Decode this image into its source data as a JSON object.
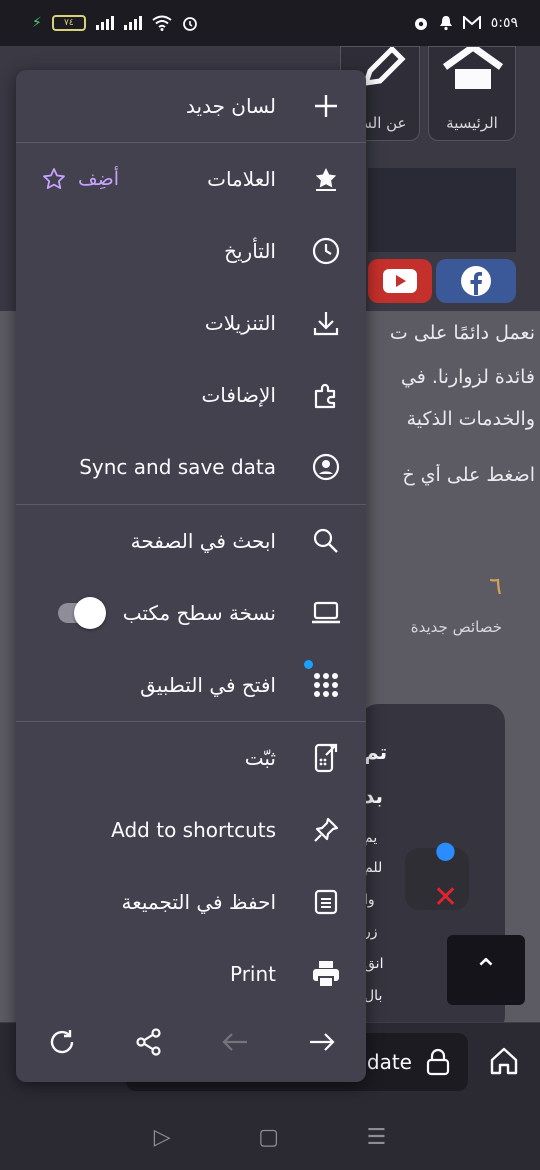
{
  "status_bar": {
    "battery": "٧٤",
    "time": "٥:٥٩",
    "icons": [
      "charging-icon",
      "signal-icon",
      "wifi-icon",
      "alarm-icon",
      "vpn-icon",
      "notification-icon",
      "gmail-icon"
    ]
  },
  "background_page": {
    "nav": [
      "الرئيسية",
      "عن الش"
    ],
    "text_lines": [
      "نعمل دائمًا على ت",
      "فائدة لزوارنا. في",
      "والخدمات الذكية",
      "اضغط على أي خ"
    ],
    "number": "٦",
    "features_label": "خصائص جديدة",
    "card_lines": [
      "تم",
      "بد",
      "يم",
      "للم",
      "وا",
      "زر",
      "انق",
      "بال"
    ],
    "url_fragment": "date"
  },
  "menu": {
    "items": {
      "new_tab": "لسان جديد",
      "bookmarks": "العلامات",
      "add_bookmark": "أضِف",
      "history": "التأريخ",
      "downloads": "التنزيلات",
      "addons": "الإضافات",
      "sync": "Sync and save data",
      "find_in_page": "ابحث في الصفحة",
      "desktop_site": "نسخة سطح مكتب",
      "open_in_app": "افتح في التطبيق",
      "install": "ثبّت",
      "add_shortcuts": "Add to shortcuts",
      "save_collection": "احفظ في التجميعة",
      "print": "Print"
    },
    "desktop_site_enabled": true,
    "accent_color": "#c7a3ff",
    "menu_bg": "#42414d"
  }
}
